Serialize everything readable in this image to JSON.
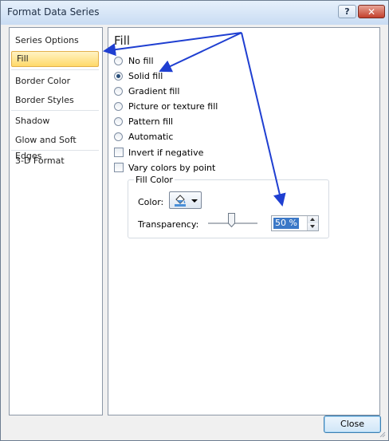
{
  "window": {
    "title": "Format Data Series",
    "help_glyph": "?",
    "close_glyph": "✕"
  },
  "nav": {
    "items": [
      {
        "label": "Series Options"
      },
      {
        "label": "Fill"
      },
      {
        "label": "Border Color"
      },
      {
        "label": "Border Styles"
      },
      {
        "label": "Shadow"
      },
      {
        "label": "Glow and Soft Edges"
      },
      {
        "label": "3-D Format"
      }
    ],
    "selected": "Fill"
  },
  "fill": {
    "title": "Fill",
    "options": [
      {
        "label": "No fill",
        "checked": false
      },
      {
        "label": "Solid fill",
        "checked": true
      },
      {
        "label": "Gradient fill",
        "checked": false
      },
      {
        "label": "Picture or texture fill",
        "checked": false
      },
      {
        "label": "Pattern fill",
        "checked": false
      },
      {
        "label": "Automatic",
        "checked": false
      }
    ],
    "checkboxes": [
      {
        "label": "Invert if negative",
        "checked": false
      },
      {
        "label": "Vary colors by point",
        "checked": false
      }
    ],
    "fill_color": {
      "group_label": "Fill Color",
      "color_label": "Color:",
      "transparency_label": "Transparency:",
      "transparency_value": "50 %",
      "transparency_slider": 0.5
    }
  },
  "buttons": {
    "close": "Close"
  },
  "icons": {
    "fill-bucket": "paint-bucket-icon",
    "dropdown": "chevron-down-icon"
  },
  "colors": {
    "accent": "#1f3fd1",
    "selected_nav": "#ffd96a",
    "highlight": "#3b78c7"
  }
}
